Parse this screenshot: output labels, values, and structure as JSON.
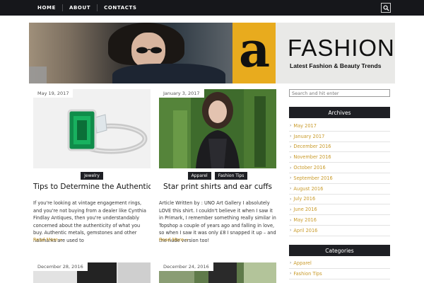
{
  "nav": {
    "links": [
      "HOME",
      "ABOUT",
      "CONTACTS"
    ],
    "search_icon": "search-icon"
  },
  "banner": {
    "logo_letter": "a",
    "title": "FASHIONY",
    "tagline": "Latest Fashion & Beauty Trends",
    "accent_color": "#e8ab1e"
  },
  "posts": [
    {
      "date": "May 19, 2017",
      "tags": [
        "Jewelry"
      ],
      "title": "Tips to Determine the Authenticity o..",
      "excerpt": "If you're looking at vintage engagement rings, and you're not buying from a dealer like Cynthia Findlay Antiques, then you're understandably concerned about the authenticity of what you buy. Authentic metals, gemstones and other hallmarks are used to",
      "read_more": "Read More »"
    },
    {
      "date": "January 3, 2017",
      "tags": [
        "Apparel",
        "Fashion Tips"
      ],
      "title": "Star print shirts and ear cuffs",
      "excerpt": "Article Written by : UNO Art Gallery I absolutely LOVE this shirt. I couldn't believe it when I saw it in Primark, I remember something really similar in Topshop a couple of years ago and falling in love, so when I saw it was only £8 I snapped it up – and the nude version too!",
      "read_more": "Read More »"
    },
    {
      "date": "December 28, 2016"
    },
    {
      "date": "December 24, 2016"
    }
  ],
  "sidebar": {
    "search_placeholder": "Search and hit enter",
    "archives_title": "Archives",
    "archives": [
      "May 2017",
      "January 2017",
      "December 2016",
      "November 2016",
      "October 2016",
      "September 2016",
      "August 2016",
      "July 2016",
      "June 2016",
      "May 2016",
      "April 2016"
    ],
    "categories_title": "Categories",
    "categories": [
      "Apparel",
      "Fashion Tips"
    ]
  },
  "colors": {
    "nav_bg": "#16171b",
    "link": "#c99a29",
    "widget_bg": "#1e1f24"
  }
}
